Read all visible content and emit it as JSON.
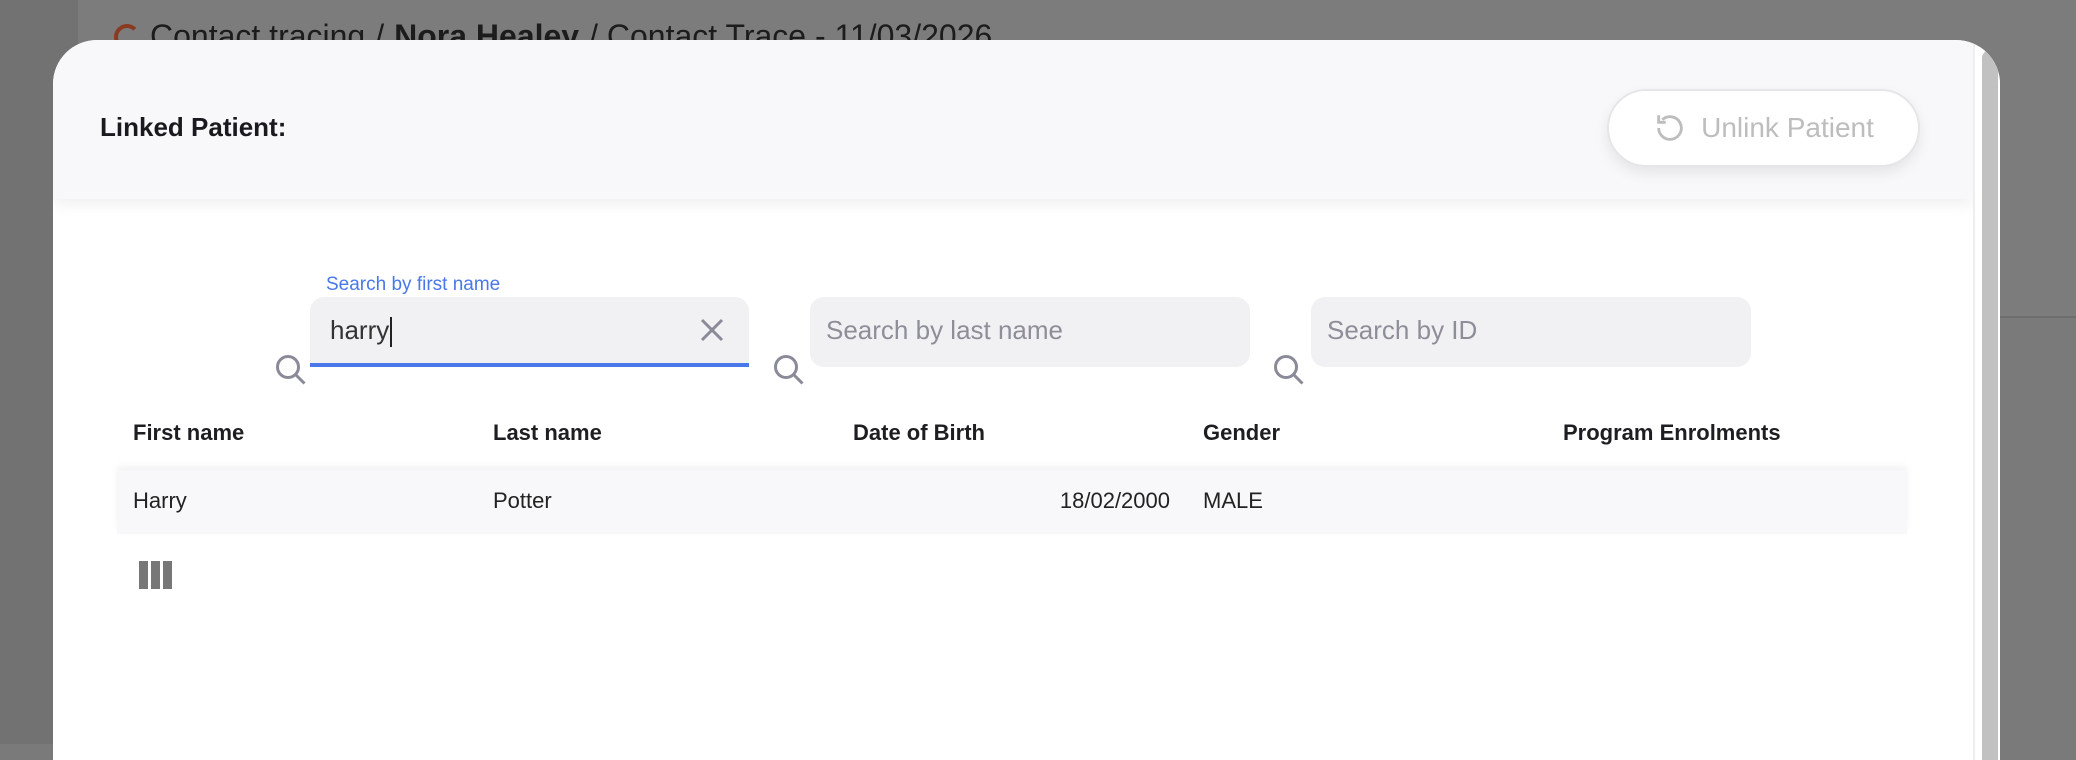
{
  "background": {
    "breadcrumb": [
      "Contact tracing",
      "/",
      "Nora Healey",
      "/ Contact Trace - 11/03/2026"
    ]
  },
  "modal": {
    "title": "Linked Patient:",
    "unlink_button": {
      "label": "Unlink Patient",
      "icon": "undo-icon"
    },
    "search": {
      "first_name": {
        "label": "Search by first name",
        "value": "harry"
      },
      "last_name": {
        "placeholder": "Search by last name",
        "value": ""
      },
      "id": {
        "placeholder": "Search by ID",
        "value": ""
      }
    },
    "table": {
      "headers": [
        "First name",
        "Last name",
        "Date of Birth",
        "Gender",
        "Program Enrolments"
      ],
      "rows": [
        {
          "first": "Harry",
          "last": "Potter",
          "dob": "18/02/2000",
          "gender": "MALE",
          "programs": ""
        }
      ]
    },
    "colors": {
      "accent": "#4a78e8"
    }
  }
}
